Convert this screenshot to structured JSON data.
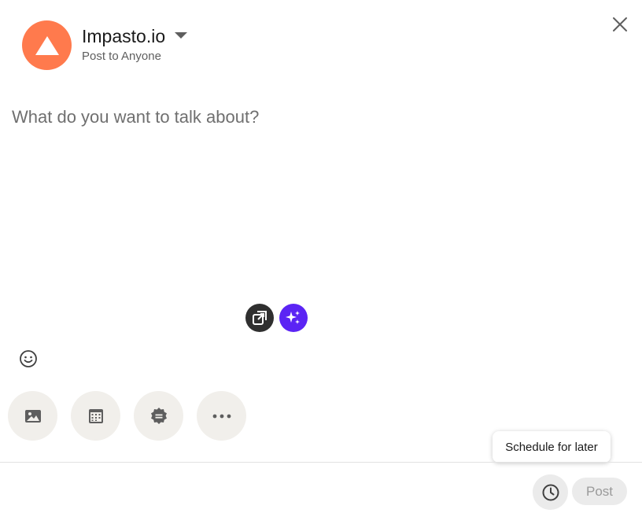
{
  "author": {
    "name": "Impasto.io",
    "visibility": "Post to Anyone",
    "avatar_color": "#ff7a4d",
    "avatar_icon": "triangle-logo-icon"
  },
  "composer": {
    "placeholder": "What do you want to talk about?",
    "value": ""
  },
  "floating_actions": [
    {
      "icon": "rewrite-icon",
      "color": "#2f2f2f"
    },
    {
      "icon": "ai-sparkle-icon",
      "color": "#5b24f4"
    }
  ],
  "emoji_icon": "emoji-icon",
  "toolbar": [
    {
      "icon": "image-icon"
    },
    {
      "icon": "calendar-icon"
    },
    {
      "icon": "badge-icon"
    },
    {
      "icon": "more-icon"
    }
  ],
  "tooltip": "Schedule for later",
  "footer": {
    "schedule_icon": "clock-icon",
    "post_label": "Post"
  }
}
